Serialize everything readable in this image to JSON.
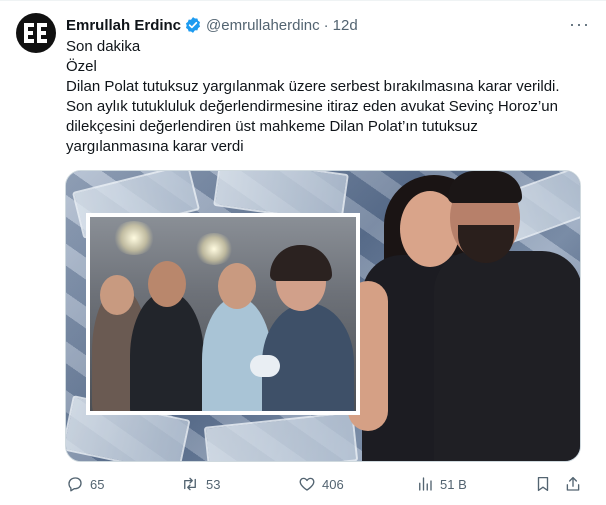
{
  "author": {
    "name": "Emrullah Erdinc",
    "handle": "@emrullaherdinc",
    "time": "12d",
    "separator": "·"
  },
  "more_label": "···",
  "tweet_lines": [
    "Son dakika",
    "Özel",
    "Dilan Polat tutuksuz yargılanmak üzere serbest bırakılmasına karar verildi.",
    "Son aylık tutukluluk değerlendirmesine itiraz eden avukat Sevinç Horoz’un",
    "dilekçesini değerlendiren üst mahkeme Dilan Polat’ın tutuksuz",
    "yargılanmasına karar verdi"
  ],
  "actions": {
    "replies": "65",
    "retweets": "53",
    "likes": "406",
    "views": "51 B"
  },
  "icons": {
    "avatar": "ee-logo-icon",
    "verified": "verified-badge-icon",
    "reply": "reply-icon",
    "retweet": "retweet-icon",
    "like": "heart-icon",
    "views": "views-chart-icon",
    "bookmark": "bookmark-icon",
    "share": "share-icon"
  },
  "colors": {
    "text": "#0f1419",
    "muted": "#536471",
    "verified": "#1d9bf0"
  }
}
